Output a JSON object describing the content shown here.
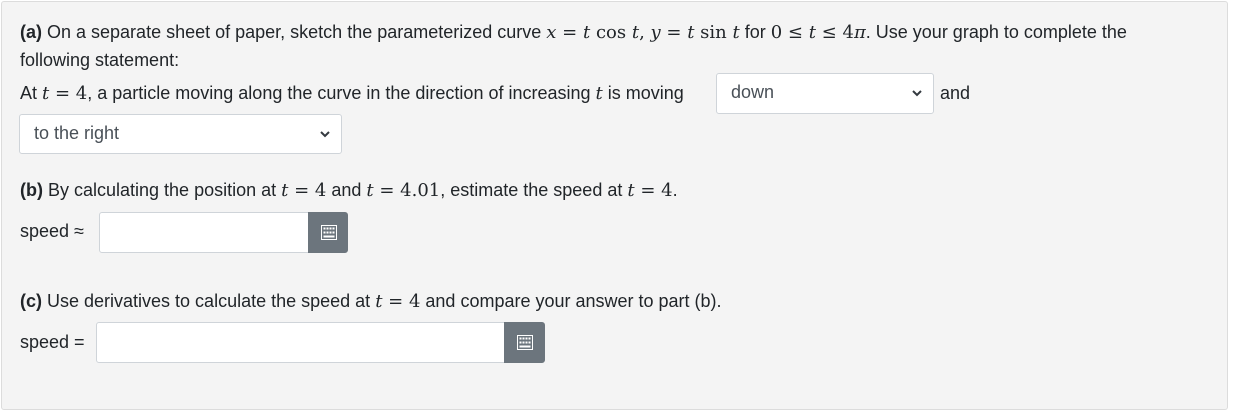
{
  "part_a": {
    "marker": "(a)",
    "text1": " On a separate sheet of paper, sketch the parameterized curve ",
    "curve_x": "x",
    "curve_eq1": " = ",
    "curve_t1": "t",
    "curve_cos": " cos ",
    "curve_t2": "t",
    "curve_comma": ",  ",
    "curve_y": "y",
    "curve_eq2": " = ",
    "curve_t3": "t",
    "curve_sin": " sin ",
    "curve_t4": "t",
    "for_text": " for ",
    "range_0": "0 ≤ ",
    "range_t": "t",
    "range_end": " ≤ 4",
    "range_pi": "π",
    "text2": ". Use your graph to complete the",
    "text3": "following statement:",
    "at_text": "At ",
    "at_t": "t",
    "at_eq": " = 4",
    "text4": ", a particle moving along the curve in the direction of increasing ",
    "text4_t": "t",
    "text5": " is moving",
    "dropdown1_value": "down",
    "and_text": "and",
    "dropdown2_value": "to the right"
  },
  "part_b": {
    "marker": "(b)",
    "text1": " By calculating the position at ",
    "t1": "t",
    "eq1": " = 4",
    "and_text": " and ",
    "t2": "t",
    "eq2": " = 4.01",
    "text2": ", estimate the speed at ",
    "t3": "t",
    "eq3": " = 4",
    "end": ".",
    "label": "speed ≈",
    "input_value": ""
  },
  "part_c": {
    "marker": "(c)",
    "text1": " Use derivatives to calculate the speed at ",
    "t1": "t",
    "eq1": " = 4",
    "text2": " and compare your answer to part (b).",
    "label": "speed =",
    "input_value": ""
  },
  "icons": {
    "keyboard": "keyboard-icon",
    "chevron": "chevron-down-icon"
  },
  "colors": {
    "button": "#6c757d",
    "panel": "#f4f4f4"
  }
}
